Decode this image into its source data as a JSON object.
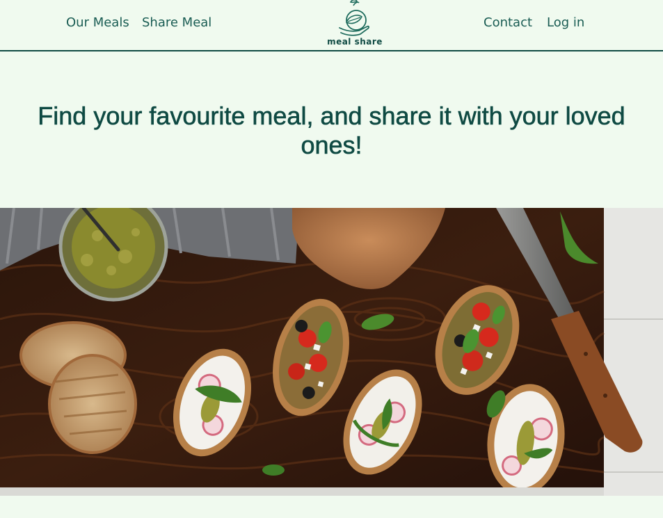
{
  "nav": {
    "our_meals": "Our Meals",
    "share_meal": "Share Meal",
    "contact": "Contact",
    "login": "Log in"
  },
  "logo": {
    "text": "meal share"
  },
  "hero": {
    "headline": "Find your favourite meal, and share it with your loved ones!",
    "image_subject": "bruschetta with cream cheese, radish, pesto and tomatoes on wooden board"
  },
  "colors": {
    "background": "#F0FAEF",
    "primary": "#0F4A43"
  }
}
